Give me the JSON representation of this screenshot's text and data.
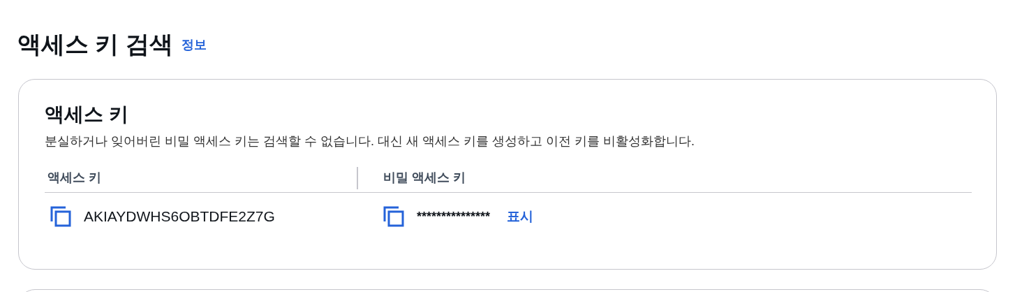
{
  "page": {
    "title": "액세스 키 검색",
    "info_link": "정보"
  },
  "card": {
    "title": "액세스 키",
    "description": "분실하거나 잊어버린 비밀 액세스 키는 검색할 수 없습니다. 대신 새 액세스 키를 생성하고 이전 키를 비활성화합니다.",
    "columns": [
      "액세스 키",
      "비밀 액세스 키"
    ],
    "access_key": "AKIAYDWHS6OBTDFE2Z7G",
    "secret_key": "***************",
    "show_link": "표시"
  }
}
